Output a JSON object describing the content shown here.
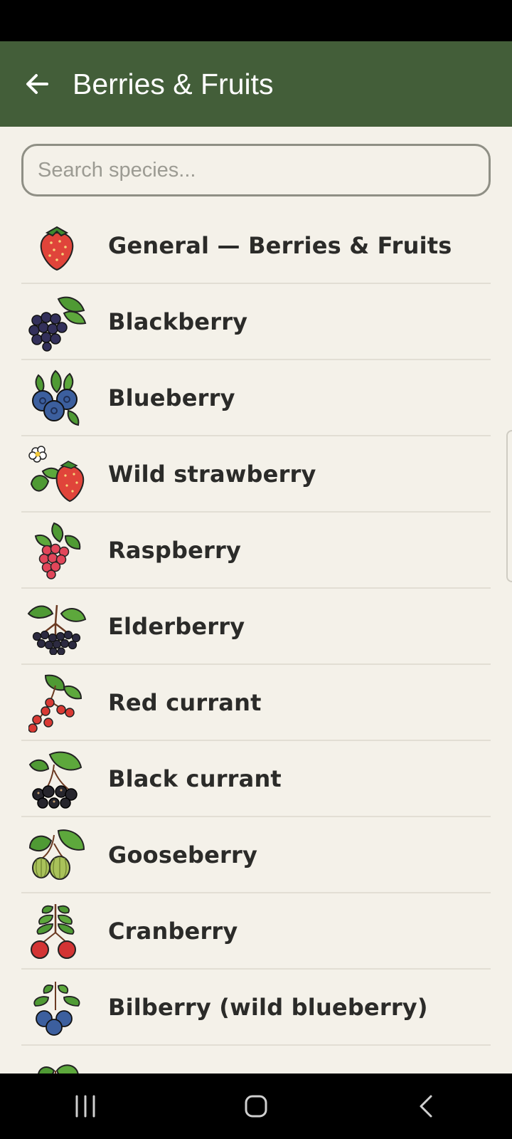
{
  "app_bar": {
    "title": "Berries & Fruits",
    "color": "#435e39",
    "back_icon": "arrow-left-icon"
  },
  "search": {
    "placeholder": "Search species...",
    "value": ""
  },
  "list": {
    "items": [
      {
        "label": "General — Berries & Fruits",
        "icon": "strawberry-icon"
      },
      {
        "label": "Blackberry",
        "icon": "blackberry-icon"
      },
      {
        "label": "Blueberry",
        "icon": "blueberry-icon"
      },
      {
        "label": "Wild strawberry",
        "icon": "wild-strawberry-icon"
      },
      {
        "label": "Raspberry",
        "icon": "raspberry-icon"
      },
      {
        "label": "Elderberry",
        "icon": "elderberry-icon"
      },
      {
        "label": "Red currant",
        "icon": "red-currant-icon"
      },
      {
        "label": "Black currant",
        "icon": "black-currant-icon"
      },
      {
        "label": "Gooseberry",
        "icon": "gooseberry-icon"
      },
      {
        "label": "Cranberry",
        "icon": "cranberry-icon"
      },
      {
        "label": "Bilberry (wild blueberry)",
        "icon": "bilberry-icon"
      },
      {
        "label": "",
        "icon": "leaf-icon"
      }
    ]
  },
  "nav_bar": {
    "buttons": [
      "recent-apps-icon",
      "home-icon",
      "back-icon"
    ]
  }
}
